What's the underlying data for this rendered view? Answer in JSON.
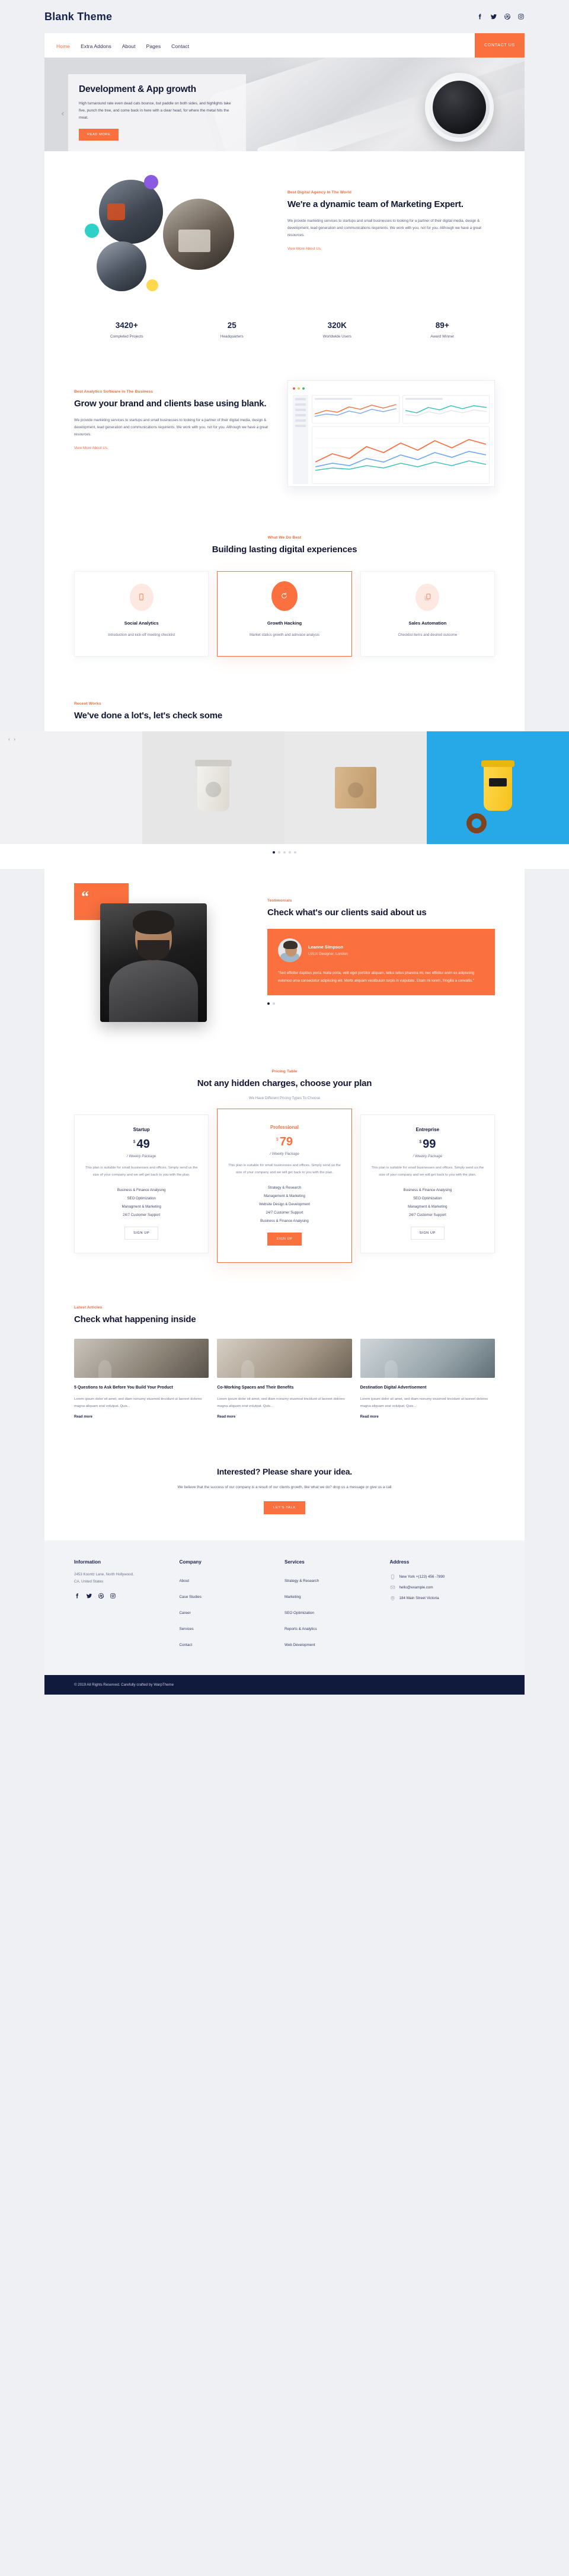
{
  "brand": "Blank Theme",
  "social_top": [
    "facebook-icon",
    "twitter-icon",
    "dribbble-icon",
    "instagram-icon"
  ],
  "nav": {
    "items": [
      "Home",
      "Extra Addons",
      "About",
      "Pages",
      "Contact"
    ],
    "active": "Home",
    "cta": "CONTACT US"
  },
  "hero": {
    "title": "Development & App growth",
    "text": "High turnaround rate even dead cats bounce, but paddle on both sides, and highlights take five, punch the tree, and come back in here with a clear head, for where the metal hits the meat.",
    "button": "READ MORE",
    "prev_arrow": "‹"
  },
  "about": {
    "label": "Best Digital Agency In The World",
    "title": "We're a dynamic team of Marketing Expert.",
    "text": "We provide marketing services to startups and small businesses to looking for a partner of their digital media, design & development, lead generation and communications requirents. We work with you, not for you. Although we have a great resources.",
    "link": "View More About Us."
  },
  "stats": [
    {
      "num": "3420+",
      "cap": "Completed Projects"
    },
    {
      "num": "25",
      "cap": "Headquarters"
    },
    {
      "num": "320K",
      "cap": "Worldwide Users"
    },
    {
      "num": "89+",
      "cap": "Award Winner"
    }
  ],
  "grow": {
    "label": "Best Analytics Software In The Business",
    "title": "Grow your brand and clients base using blank.",
    "text": "We provide marketing services to startups and small businesses to looking for a partner of their digital media, design & development, lead generation and communications requirents. We work with you, not for you. Although we have a great resources.",
    "link": "View More About Us."
  },
  "services": {
    "label": "What We Do Best",
    "title": "Building lasting digital experiences",
    "cards": [
      {
        "icon": "mobile-icon",
        "title": "Social Analytics",
        "text": "Introduction and kick-off meeting checklist",
        "featured": false
      },
      {
        "icon": "refresh-icon",
        "title": "Growth Hacking",
        "text": "Market statics growth and adnvace analysis",
        "featured": true
      },
      {
        "icon": "copy-icon",
        "title": "Sales Automation",
        "text": "Checklist items and desired outcome",
        "featured": false
      }
    ]
  },
  "works": {
    "label": "Recent Works",
    "title": "We've done a lot's, let's check some",
    "prev": "‹",
    "next": "›",
    "dots": 5,
    "active_dot": 1
  },
  "testimonials": {
    "label": "Testimonials",
    "title": "Check what's our clients said about us",
    "quote_mark": "“",
    "name": "Leanne Simpson",
    "role": "UI/UX Designer, London",
    "quote": "\"Sed efficitur dapibus porta. Nulla porta, velit eget porttitor aliquam, tellus tellus pharetra mi, nec efficitur enim ex adipiscing euismod urna consectetur adipiscing elit. Morbi aliquam vestibulum turpis in vulputate. Etiam mi lorem, fringilla a convallis.\"",
    "dots": 2,
    "active_dot": 1
  },
  "pricing": {
    "label": "Pricing Table",
    "title": "Not any hidden charges, choose your plan",
    "subtitle": "We Have Different Pricing Types To Choose",
    "plans": [
      {
        "name": "Startup",
        "currency": "$",
        "amount": "49",
        "period": "/ Weekly Package",
        "desc": "This plan is suitable for small businesses and offices. Simply send us the size of your company and we will get back to you with the plan.",
        "features": [
          "Business & Finance Analysing",
          "SEO Optimization",
          "Managment & Marketing",
          "24/7 Customer Support"
        ],
        "button": "SIGN UP",
        "featured": false
      },
      {
        "name": "Professional",
        "currency": "$",
        "amount": "79",
        "period": "/ Weekly Package",
        "desc": "This plan is suitable for small businesses and offices. Simply send us the size of your company and we will get back to you with the plan.",
        "features": [
          "Strategy & Research",
          "Management & Marketing",
          "Website Design & Development",
          "24/7 Customer Support",
          "Business & Finance Analysing"
        ],
        "button": "SIGN UP",
        "featured": true
      },
      {
        "name": "Entreprise",
        "currency": "$",
        "amount": "99",
        "period": "/ Weekly Package",
        "desc": "This plan is suitable for small businesses and offices. Simply send us the size of your company and we will get back to you with the plan.",
        "features": [
          "Business & Finance Analysing",
          "SEO Optimization",
          "Managment & Marketing",
          "24/7 Customer Support"
        ],
        "button": "SIGN UP",
        "featured": false
      }
    ]
  },
  "articles": {
    "label": "Latest Articles",
    "title": "Check what happening inside",
    "items": [
      {
        "title": "5 Questions to Ask Before You Build Your Product",
        "text": "Lorem ipsum dolor sit amet, sed diam nonumy eiusmod tincidunt ut laoreet dolores magna aliquam erat volutpat. Quis...",
        "link": "Read more"
      },
      {
        "title": "Co-Working Spaces and Their Benefits",
        "text": "Lorem ipsum dolor sit amet, sed diam nonumy eiusmod tincidunt ut laoreet dolores magna aliquam erat volutpat. Quis...",
        "link": "Read more"
      },
      {
        "title": "Destination Digital Advertisement",
        "text": "Lorem ipsum dolor sit amet, sed diam nonumy eiusmod tincidunt ut laoreet dolores magna aliquam erat volutpat. Quis...",
        "link": "Read more"
      }
    ]
  },
  "cta": {
    "title": "Interested? Please share your idea.",
    "text": "We believe that the success of our company is a result of our clients growth, like what we do? drop us a message or give us a call",
    "button": "LET'S TALK"
  },
  "footer": {
    "information": {
      "heading": "Information",
      "address": "2453 Koontz Lane, North Hollywood, CA, United States",
      "social": [
        "facebook-icon",
        "twitter-icon",
        "dribbble-icon",
        "instagram-icon"
      ]
    },
    "company": {
      "heading": "Company",
      "links": [
        "About",
        "Case Studies",
        "Career",
        "Services",
        "Contact"
      ]
    },
    "services": {
      "heading": "Services",
      "links": [
        "Strategy & Research",
        "Marketing",
        "SEO Optimization",
        "Reports & Analytics",
        "Web Development"
      ]
    },
    "address": {
      "heading": "Address",
      "lines": [
        {
          "icon": "phone-icon",
          "text": "New York +(123) 456 -7890"
        },
        {
          "icon": "mail-icon",
          "text": "hello@example.com"
        },
        {
          "icon": "pin-icon",
          "text": "184 Main Street Victoria"
        }
      ]
    },
    "copyright": "© 2019 All Rights Reserved. Carefully crafted by WarpTheme"
  },
  "colors": {
    "accent": "#fa703f",
    "ink": "#18214a",
    "footer_dark": "#101a3d"
  }
}
